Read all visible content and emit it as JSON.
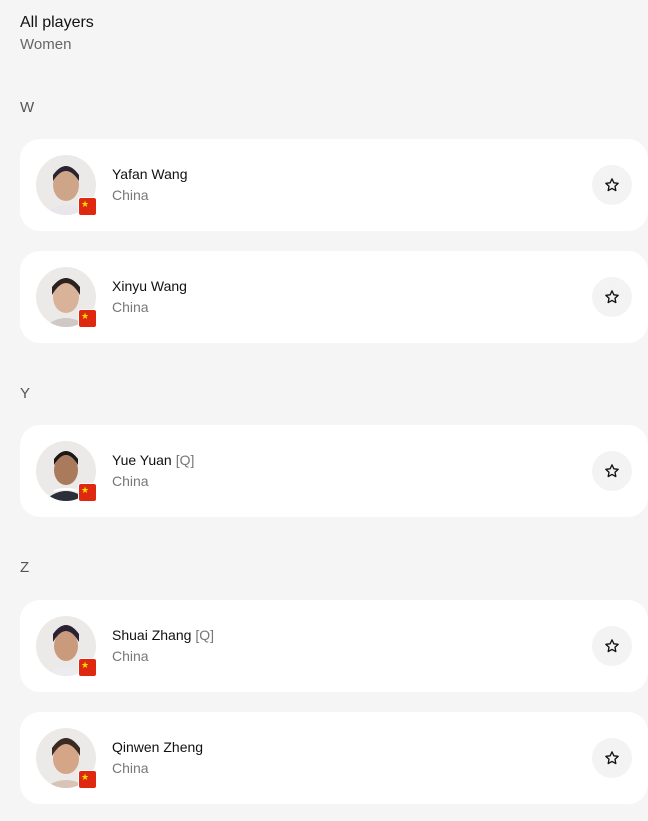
{
  "header": {
    "title": "All players",
    "subtitle": "Women"
  },
  "sections": [
    {
      "letter": "W",
      "players": [
        {
          "name": "Yafan Wang",
          "tag": "",
          "country": "China"
        },
        {
          "name": "Xinyu Wang",
          "tag": "",
          "country": "China"
        }
      ]
    },
    {
      "letter": "Y",
      "players": [
        {
          "name": "Yue Yuan",
          "tag": "[Q]",
          "country": "China"
        }
      ]
    },
    {
      "letter": "Z",
      "players": [
        {
          "name": "Shuai Zhang",
          "tag": "[Q]",
          "country": "China"
        },
        {
          "name": "Qinwen Zheng",
          "tag": "",
          "country": "China"
        }
      ]
    }
  ],
  "icons": {
    "favorite": "star-outline-icon",
    "flag": "china-flag-icon"
  },
  "colors": {
    "background": "#f5f5f5",
    "card": "#ffffff",
    "flag_red": "#de2910",
    "flag_star": "#ffde00"
  }
}
